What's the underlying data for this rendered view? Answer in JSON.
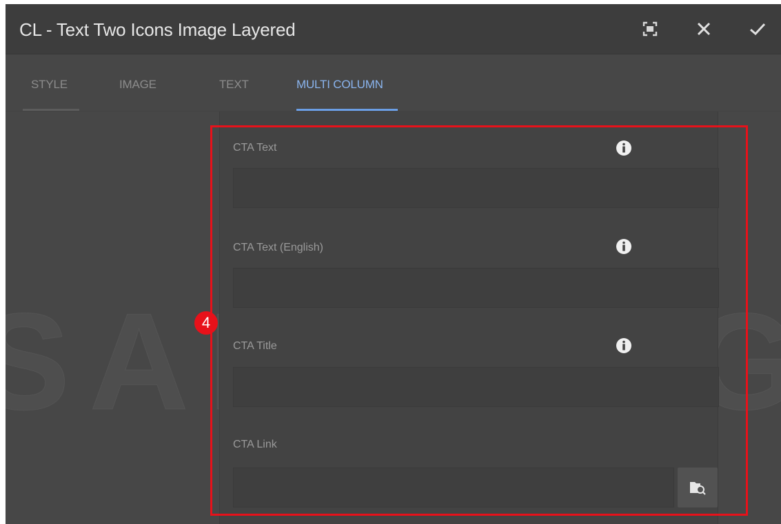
{
  "dialog": {
    "title": "CL - Text Two Icons Image Layered",
    "buttons": {
      "fullscreen_icon": "fullscreen-icon",
      "close_icon": "close-icon",
      "confirm_icon": "check-icon"
    }
  },
  "tabs": [
    {
      "label": "STYLE",
      "active": false
    },
    {
      "label": "IMAGE",
      "active": false
    },
    {
      "label": "TEXT",
      "active": false
    },
    {
      "label": "MULTI COLUMN",
      "active": true
    }
  ],
  "fields": [
    {
      "label": "CTA Text",
      "value": "",
      "has_info": true
    },
    {
      "label": "CTA Text (English)",
      "value": "",
      "has_info": true
    },
    {
      "label": "CTA Title",
      "value": "",
      "has_info": true
    },
    {
      "label": "CTA Link",
      "value": "",
      "has_info": false,
      "has_browse": true
    }
  ],
  "watermark": "SAMSUNG",
  "annotation": {
    "step": "4"
  },
  "colors": {
    "accent": "#6b9fe6",
    "highlight": "#e8111a",
    "background": "#474747"
  }
}
